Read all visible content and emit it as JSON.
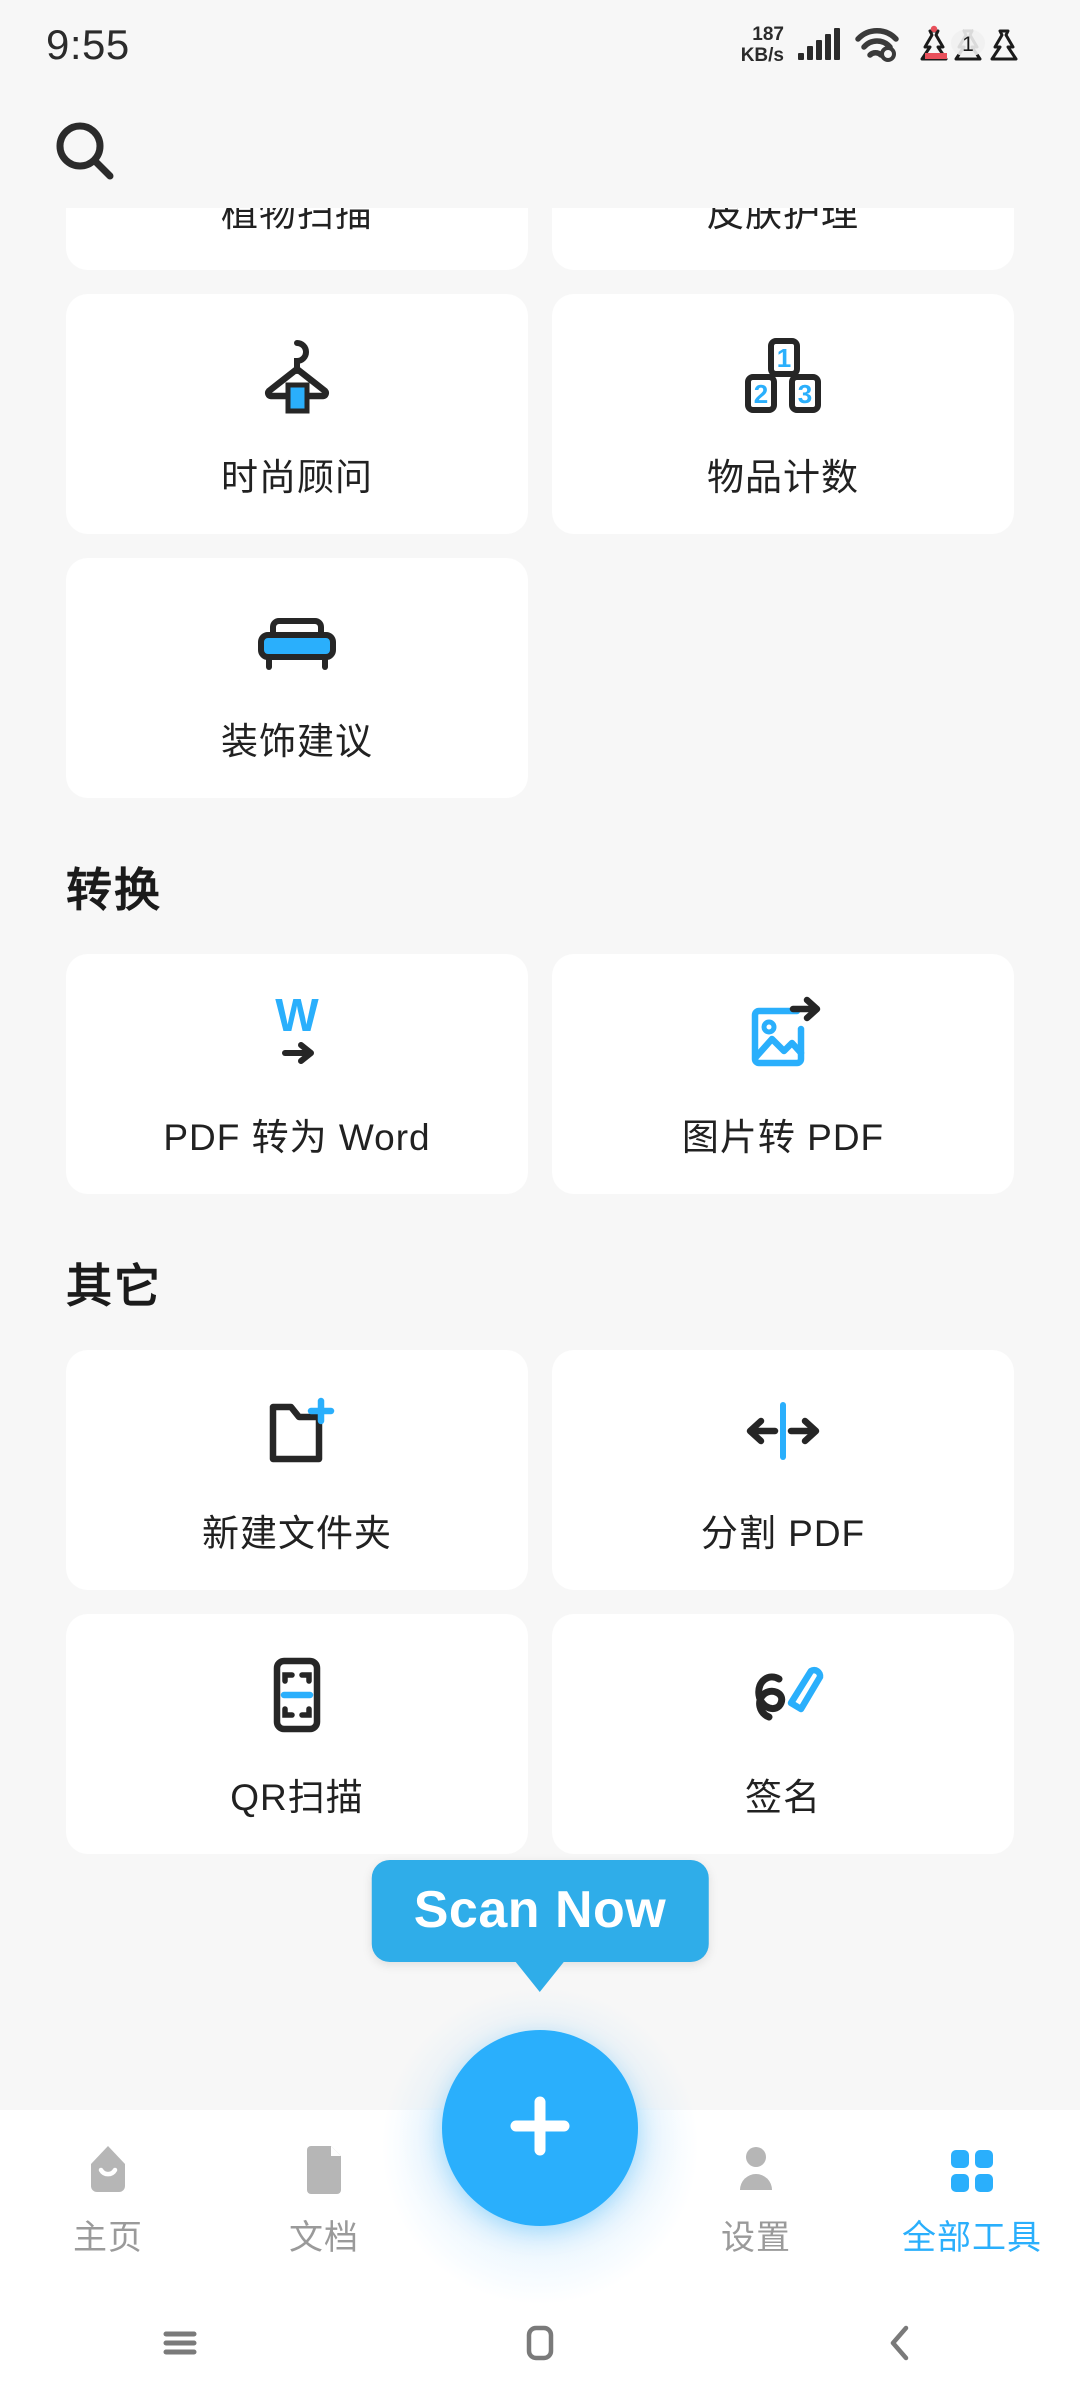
{
  "statusbar": {
    "time": "9:55",
    "net_speed_value": "187",
    "net_speed_unit": "KB/s",
    "signal_icon": "signal-bars-icon",
    "wifi_icon": "wifi-icon",
    "battery_icon": "battery-tree-icon",
    "notification_count": "1"
  },
  "header": {
    "search_icon": "search-icon"
  },
  "sections": [
    {
      "title": "",
      "items": [
        {
          "label": "植物扫描",
          "icon": "plant-scan-icon",
          "clipped": true
        },
        {
          "label": "皮肤护理",
          "icon": "skin-care-icon",
          "clipped": true
        },
        {
          "label": "时尚顾问",
          "icon": "clothes-hanger-icon",
          "clipped": false
        },
        {
          "label": "物品计数",
          "icon": "number-blocks-icon",
          "clipped": false
        },
        {
          "label": "装饰建议",
          "icon": "sofa-icon",
          "clipped": false
        }
      ]
    },
    {
      "title": "转换",
      "items": [
        {
          "label": "PDF 转为 Word",
          "icon": "word-convert-icon"
        },
        {
          "label": "图片转 PDF",
          "icon": "image-to-pdf-icon"
        }
      ]
    },
    {
      "title": "其它",
      "items": [
        {
          "label": "新建文件夹",
          "icon": "new-folder-icon"
        },
        {
          "label": "分割 PDF",
          "icon": "split-pdf-icon"
        },
        {
          "label": "QR扫描",
          "icon": "qr-scan-icon"
        },
        {
          "label": "签名",
          "icon": "signature-icon"
        }
      ]
    }
  ],
  "tooltip": {
    "text": "Scan Now"
  },
  "fab": {
    "icon": "plus-icon",
    "label": "+"
  },
  "bottom_nav": [
    {
      "label": "主页",
      "icon": "home-icon",
      "active": false
    },
    {
      "label": "文档",
      "icon": "document-icon",
      "active": false
    },
    {
      "label": "设置",
      "icon": "person-settings-icon",
      "active": false
    },
    {
      "label": "全部工具",
      "icon": "grid-apps-icon",
      "active": true
    }
  ],
  "system_nav": [
    {
      "name": "recents-icon"
    },
    {
      "name": "home-square-icon"
    },
    {
      "name": "back-chevron-icon"
    }
  ],
  "colors": {
    "accent": "#2aaffc",
    "tooltip_bg": "#2fade9",
    "background": "#f7f7f7",
    "card": "#ffffff",
    "text": "#212121",
    "muted": "#9a9a9a"
  }
}
